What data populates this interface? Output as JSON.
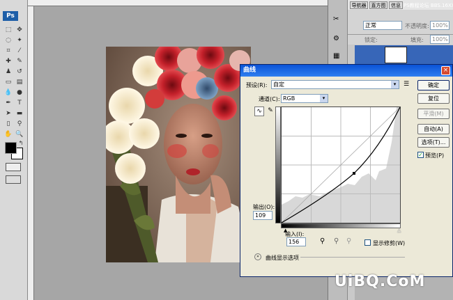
{
  "app": {
    "logo": "Ps"
  },
  "right_panel": {
    "tabs": [
      "导航器",
      "直方图",
      "信息"
    ],
    "watermark_top": "PS教程论坛 BBS.16XX8.COM",
    "blend_mode": "正常",
    "opacity_label": "不透明度:",
    "opacity_value": "100%",
    "lock_label": "锁定:",
    "fill_label": "填充:",
    "fill_value": "100%"
  },
  "dialog": {
    "title": "曲线",
    "preset_label": "预设(R):",
    "preset_value": "自定",
    "channel_label": "通道(C):",
    "channel_value": "RGB",
    "ok_label": "确定",
    "reset_label": "复位",
    "smooth_label": "平滑(M)",
    "auto_label": "自动(A)",
    "options_label": "选项(T)...",
    "preview_label": "预览(P)",
    "preview_checked": true,
    "output_label": "输出(O):",
    "output_value": "109",
    "input_label": "输入(I):",
    "input_value": "156",
    "show_clipping_label": "显示修剪(W)",
    "curve_options_label": "曲线显示选项"
  },
  "watermark": "UiBQ.CoM"
}
